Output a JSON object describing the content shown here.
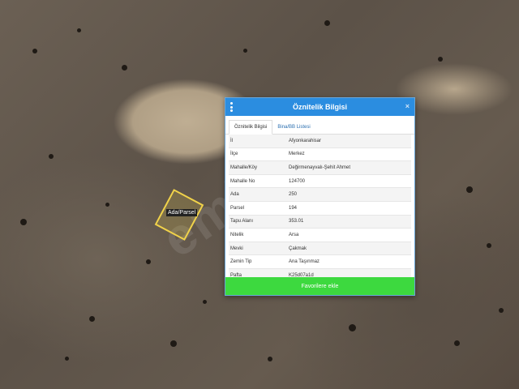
{
  "map": {
    "parcel_label": "Ada/Parsel"
  },
  "panel": {
    "title": "Öznitelik Bilgisi",
    "close": "×",
    "tabs": [
      {
        "label": "Öznitelik Bilgisi",
        "active": true
      },
      {
        "label": "Bina/BB Listesi",
        "active": false
      }
    ],
    "rows": [
      {
        "key": "İl",
        "value": "Afyonkarahisar"
      },
      {
        "key": "İlçe",
        "value": "Merkez"
      },
      {
        "key": "Mahalle/Köy",
        "value": "Değirmenayvalı-Şehit Ahmet"
      },
      {
        "key": "Mahalle No",
        "value": "124700"
      },
      {
        "key": "Ada",
        "value": "250"
      },
      {
        "key": "Parsel",
        "value": "194"
      },
      {
        "key": "Tapu Alanı",
        "value": "353.01"
      },
      {
        "key": "Nitelik",
        "value": "Arsa"
      },
      {
        "key": "Mevki",
        "value": "Çakmak"
      },
      {
        "key": "Zemin Tip",
        "value": "Ana Taşınmaz"
      },
      {
        "key": "Pafta",
        "value": "K25d07a1d"
      }
    ],
    "favorites_button": "Favorilere ekle"
  },
  "colors": {
    "header": "#2b8de0",
    "button": "#3dd93f",
    "parcel": "#f0d24a"
  }
}
